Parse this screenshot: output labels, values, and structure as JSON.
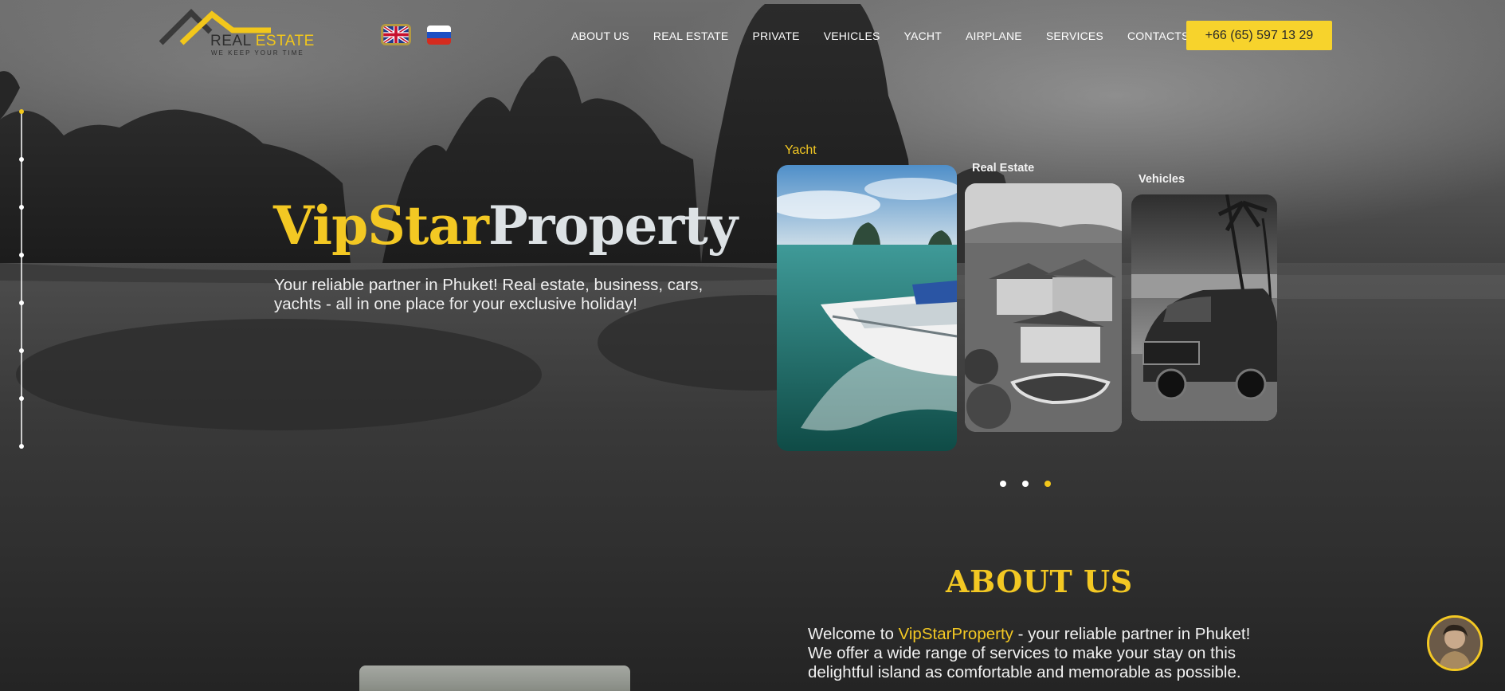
{
  "header": {
    "logo": {
      "word1": "REAL",
      "word2": "ESTATE",
      "tagline": "WE KEEP YOUR TIME"
    },
    "languages": [
      {
        "code": "en",
        "icon": "uk-flag-icon",
        "active": true
      },
      {
        "code": "ru",
        "icon": "russia-flag-icon",
        "active": false
      }
    ],
    "nav": [
      {
        "label": "ABOUT US"
      },
      {
        "label": "REAL ESTATE"
      },
      {
        "label": "PRIVATE"
      },
      {
        "label": "VEHICLES"
      },
      {
        "label": "YACHT"
      },
      {
        "label": "AIRPLANE"
      },
      {
        "label": "SERVICES"
      },
      {
        "label": "CONTACTS"
      }
    ],
    "phone": "+66 (65) 597 13 29"
  },
  "hero": {
    "title_part1": "VipStar",
    "title_part2": "Property",
    "subtitle": "Your reliable partner in Phuket! Real estate, business, cars, yachts - all in one place for your exclusive holiday!"
  },
  "carousel": {
    "cards": [
      {
        "label": "Yacht",
        "image": "yacht-photo"
      },
      {
        "label": "Real Estate",
        "image": "villa-photo"
      },
      {
        "label": "Vehicles",
        "image": "minivan-photo"
      }
    ],
    "page_count": 3,
    "active_page": 3
  },
  "about": {
    "title": "ABOUT US",
    "text_before": "Welcome to ",
    "brand": "VipStarProperty",
    "text_after": " - your reliable partner in Phuket! We offer a wide range of services to make your stay on this delightful island as comfortable and memorable as possible."
  },
  "side_indicator": {
    "sections": 8,
    "active_section": 1
  },
  "colors": {
    "accent": "#f3c823",
    "background": "#262626",
    "phone_button": "#f7d32c"
  },
  "chat": {
    "icon": "chat-avatar-icon"
  }
}
